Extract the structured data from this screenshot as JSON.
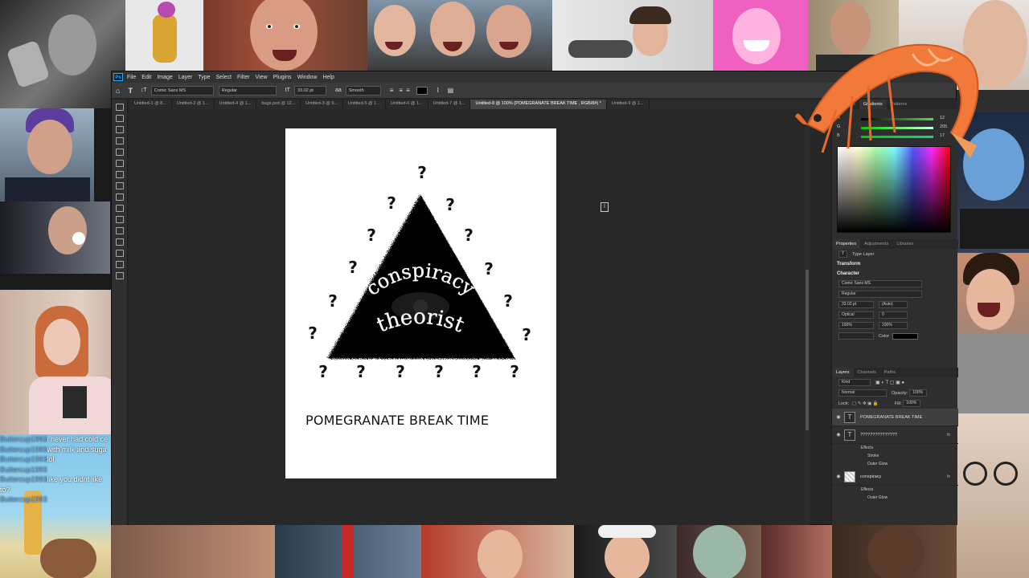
{
  "photoshop": {
    "app_logo": "Ps",
    "menu": [
      "File",
      "Edit",
      "Image",
      "Layer",
      "Type",
      "Select",
      "Filter",
      "View",
      "Plugins",
      "Window",
      "Help"
    ],
    "options": {
      "font_family": "Comic Sans MS",
      "font_style": "Regular",
      "font_size": "33.02 pt",
      "antialias": "Smooth",
      "color": "#000000"
    },
    "tabs": [
      "Untitled-1 @ 8...",
      "Untitled-2 @ 1...",
      "Untitled-4 @ 1...",
      "bugs.psd @ 12...",
      "Untitled-3 @ 9...",
      "Untitled-5 @ 1...",
      "Untitled-6 @ 1...",
      "Untitled-7 @ 1...",
      "Untitled-8 @ 100% (POMEGRANATE BREAK TIME , RGB/8#) *",
      "Untitled-9 @ 1..."
    ],
    "active_tab_index": 8,
    "document": {
      "caption": "POMEGRANATE BREAK TIME",
      "triangle_text_line1": "conspiracy",
      "triangle_text_line2": "theorist",
      "question_glyph": "?"
    },
    "color_panel": {
      "tabs": [
        "Swatches",
        "Gradients",
        "Patterns"
      ],
      "channels": [
        {
          "label": "R",
          "value": "12",
          "color": "#44dd33"
        },
        {
          "label": "G",
          "value": "205",
          "color": "#44dd33"
        },
        {
          "label": "B",
          "value": "17",
          "color": "#44dd33"
        }
      ]
    },
    "properties": {
      "tabs": [
        "Properties",
        "Adjustments",
        "Libraries"
      ],
      "layer_type": "Type Layer",
      "transform_label": "Transform",
      "character_label": "Character",
      "font": "Comic Sans MS",
      "style": "Regular",
      "size": "33.02 pt",
      "leading": "(Auto)",
      "kerning": "Optical",
      "tracking": "0",
      "vscale": "100%",
      "hscale": "100%",
      "color_label": "Color"
    },
    "layers": {
      "tabs": [
        "Layers",
        "Channels",
        "Paths"
      ],
      "filter_kind": "Kind",
      "blend_mode": "Normal",
      "opacity_label": "Opacity:",
      "opacity": "100%",
      "lock_label": "Lock:",
      "fill_label": "Fill:",
      "fill": "100%",
      "items": [
        {
          "name": "POMEGRANATE BREAK TIME",
          "kind": "T",
          "fx": "",
          "selected": true
        },
        {
          "name": "???????????????",
          "kind": "T",
          "fx": "fx",
          "selected": false,
          "effects": [
            "Effects",
            "Stroke",
            "Outer Glow"
          ]
        },
        {
          "name": "conspiracy",
          "kind": "img",
          "fx": "fx",
          "selected": false,
          "effects": [
            "Effects",
            "Outer Glow"
          ]
        }
      ]
    }
  },
  "chat": {
    "lines": [
      {
        "user": "Buttercup1993",
        "text": "i never had cold ce"
      },
      {
        "user": "Buttercup1993",
        "text": "with milk and suga"
      },
      {
        "user": "Buttercup1993",
        "text": "lol"
      },
      {
        "user": "Buttercup1993",
        "text": ""
      },
      {
        "user": "Buttercup1993",
        "text": "like you didnt like"
      },
      {
        "user": "",
        "text": "to?"
      },
      {
        "user": "Buttercup1993",
        "text": ""
      }
    ]
  }
}
